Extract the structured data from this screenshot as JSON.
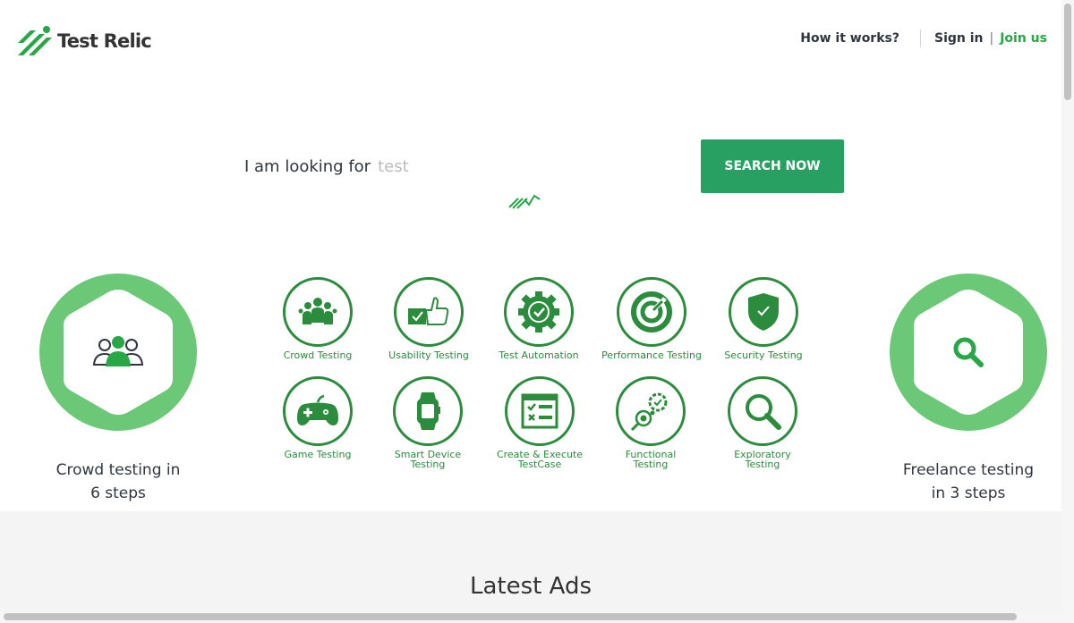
{
  "header": {
    "logo_text": "Test Relic",
    "nav": {
      "how_it_works": "How it works?",
      "sign_in": "Sign in",
      "separator": "|",
      "join_us": "Join us"
    }
  },
  "search": {
    "label": "I am looking for",
    "value": "test",
    "button": "SEARCH NOW"
  },
  "left_block": {
    "title_line1": "Crowd testing in",
    "title_line2": "6 steps",
    "icon": "people-group-icon"
  },
  "right_block": {
    "title_line1": "Freelance testing",
    "title_line2": "in 3 steps",
    "icon": "magnifier-icon"
  },
  "categories": [
    {
      "label": "Crowd Testing",
      "icon": "crowd-icon"
    },
    {
      "label": "Usability Testing",
      "icon": "thumbs-up-icon"
    },
    {
      "label": "Test Automation",
      "icon": "gear-check-icon"
    },
    {
      "label": "Performance Testing",
      "icon": "gauge-icon"
    },
    {
      "label": "Security Testing",
      "icon": "shield-icon"
    },
    {
      "label": "Game Testing",
      "icon": "gamepad-icon"
    },
    {
      "label_line1": "Smart Device",
      "label_line2": "Testing",
      "icon": "smartwatch-icon"
    },
    {
      "label_line1": "Create & Execute",
      "label_line2": "TestCase",
      "icon": "checklist-icon"
    },
    {
      "label_line1": "Functional",
      "label_line2": "Testing",
      "icon": "functional-icon"
    },
    {
      "label_line1": "Exploratory",
      "label_line2": "Testing",
      "icon": "search-icon"
    }
  ],
  "latest": {
    "title": "Latest Ads"
  },
  "colors": {
    "brand_green": "#27a062",
    "icon_green": "#2a8c3c",
    "hex_green": "#6ac876",
    "join_green": "#27a745"
  }
}
